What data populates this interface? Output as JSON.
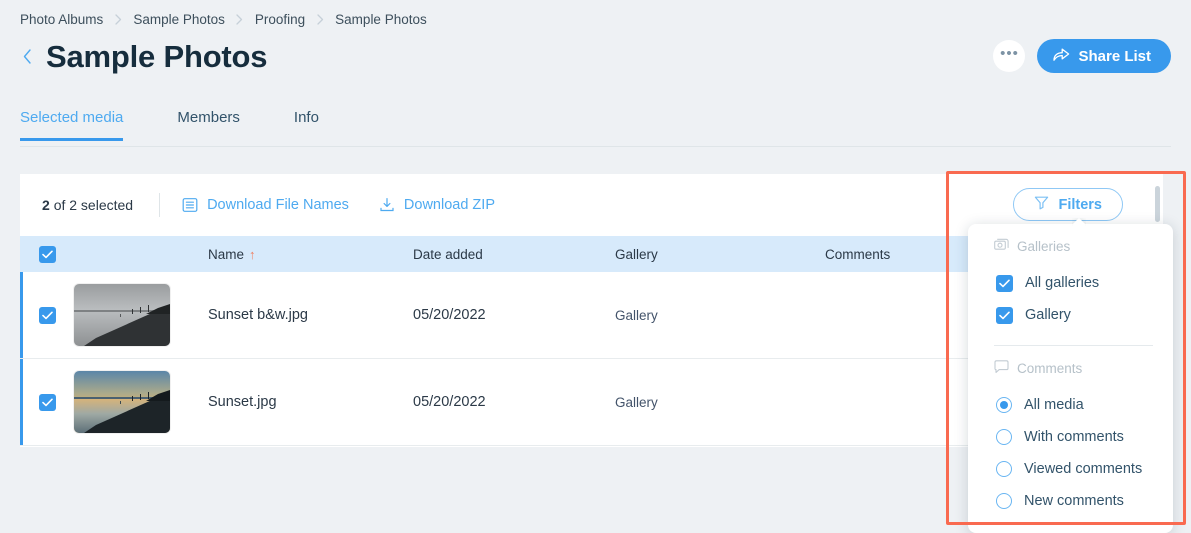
{
  "breadcrumb": {
    "items": [
      "Photo Albums",
      "Sample Photos",
      "Proofing",
      "Sample Photos"
    ],
    "separator_icon": "chevron-right-icon"
  },
  "header": {
    "back_icon": "chevron-left-icon",
    "title": "Sample Photos",
    "more_label": "•••",
    "more_icon": "ellipsis-icon",
    "share_label": "Share List",
    "share_icon": "share-icon"
  },
  "tabs": [
    {
      "label": "Selected media",
      "active": true
    },
    {
      "label": "Members",
      "active": false
    },
    {
      "label": "Info",
      "active": false
    }
  ],
  "toolbar": {
    "selected_count": "2",
    "selected_suffix": "of 2 selected",
    "download_file_names_label": "Download File Names",
    "download_file_names_icon": "list-icon",
    "download_zip_label": "Download ZIP",
    "download_zip_icon": "download-icon",
    "filters_label": "Filters",
    "filters_icon": "funnel-icon"
  },
  "table": {
    "columns": {
      "name": "Name",
      "sort_indicator": "↑",
      "date_added": "Date added",
      "gallery": "Gallery",
      "comments": "Comments"
    },
    "header_checkbox_checked": true,
    "rows": [
      {
        "checked": true,
        "thumbnail": "grayscale-seascape-thumbnail",
        "name": "Sunset b&w.jpg",
        "date_added": "05/20/2022",
        "gallery": "Gallery",
        "comments": ""
      },
      {
        "checked": true,
        "thumbnail": "color-sunset-thumbnail",
        "name": "Sunset.jpg",
        "date_added": "05/20/2022",
        "gallery": "Gallery",
        "comments": ""
      }
    ]
  },
  "filter_panel": {
    "galleries": {
      "title": "Galleries",
      "icon": "gallery-icon",
      "options": [
        {
          "label": "All galleries",
          "checked": true
        },
        {
          "label": "Gallery",
          "checked": true
        }
      ]
    },
    "comments": {
      "title": "Comments",
      "icon": "comment-bubble-icon",
      "options": [
        {
          "label": "All media",
          "selected": true
        },
        {
          "label": "With comments",
          "selected": false
        },
        {
          "label": "Viewed comments",
          "selected": false
        },
        {
          "label": "Viewed comments",
          "selected": false
        }
      ],
      "option_labels": [
        "All media",
        "With comments",
        "Viewed comments",
        "New comments"
      ]
    }
  },
  "colors": {
    "accent_blue": "#3899ec",
    "light_blue": "#4eaaf0",
    "header_row_blue": "#d7eafb",
    "page_bg": "#eef1f4",
    "annotation_red": "#f96a50",
    "sort_arrow": "#f07f5f"
  }
}
